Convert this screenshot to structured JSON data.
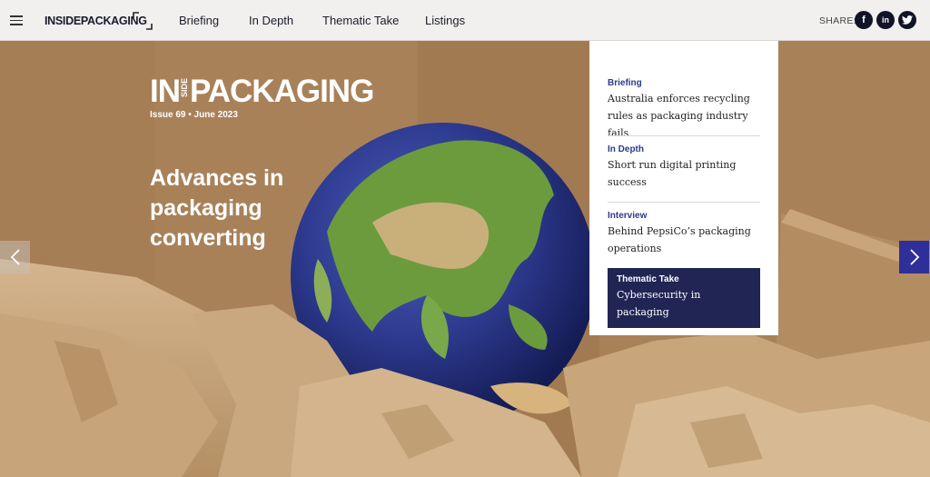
{
  "header": {
    "logo": "INSIDEPACKAGING",
    "nav": [
      "Briefing",
      "In Depth",
      "Thematic Take",
      "Listings"
    ],
    "share_label": "SHARE:",
    "share_icons": [
      {
        "name": "facebook-icon",
        "glyph": "f"
      },
      {
        "name": "linkedin-icon",
        "glyph": "in"
      },
      {
        "name": "twitter-icon",
        "glyph": "t"
      }
    ]
  },
  "hero": {
    "logo_in": "IN",
    "logo_side": "SIDE",
    "logo_packaging": "PACKAGING",
    "issue": "Issue 69 • June 2023",
    "headline": "Advances in packaging converting",
    "prev_icon": "chevron-left-icon",
    "next_icon": "chevron-right-icon"
  },
  "panel": {
    "items": [
      {
        "category": "Briefing",
        "title": "Australia enforces recycling rules as packaging industry fails"
      },
      {
        "category": "In Depth",
        "title": "Short run digital printing success"
      },
      {
        "category": "Interview",
        "title": "Behind PepsiCo’s packaging operations"
      },
      {
        "category": "Thematic Take",
        "title": "Cybersecurity in packaging"
      }
    ]
  },
  "colors": {
    "accent": "#212554",
    "category": "#2d3a8c",
    "share_bg": "#111427",
    "next_arrow": "#2f2f9a"
  }
}
